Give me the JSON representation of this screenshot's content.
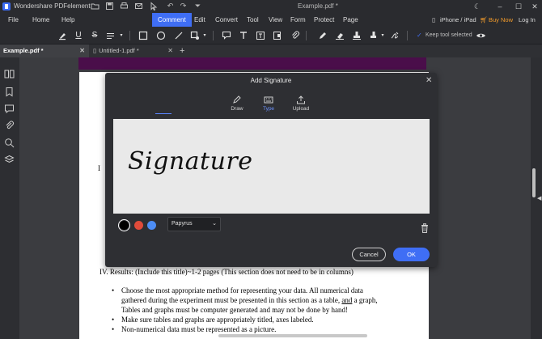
{
  "app": {
    "name": "Wondershare PDFelement",
    "document_title": "Example.pdf *"
  },
  "menu": {
    "items": [
      "File",
      "Home",
      "Help",
      "Comment",
      "Edit",
      "Convert",
      "Tool",
      "View",
      "Form",
      "Protect",
      "Page"
    ],
    "active": "Comment",
    "device": "iPhone / iPad",
    "buy_now": "Buy Now",
    "login": "Log In"
  },
  "toolbar": {
    "keep_tool_selected": "Keep tool selected"
  },
  "tabs": [
    {
      "label": "Example.pdf *",
      "active": true
    },
    {
      "label": "Untitled-1.pdf *",
      "active": false
    }
  ],
  "dialog": {
    "title": "Add Signature",
    "modes": [
      {
        "label": "Draw",
        "icon": "pen-draw-icon"
      },
      {
        "label": "Type",
        "icon": "keyboard-icon"
      },
      {
        "label": "Upload",
        "icon": "upload-icon"
      }
    ],
    "active_mode": "Type",
    "signature_text": "Signature",
    "colors": [
      "#000000",
      "#e04b3a",
      "#4d8df5"
    ],
    "selected_color": "#000000",
    "font": "Papyrus",
    "cancel_label": "Cancel",
    "ok_label": "OK"
  },
  "document": {
    "stray_letter": "I",
    "heading": "IV. Results: (Include this title)~1-2 pages (This section does not need to be in columns)",
    "bullets": [
      "Choose the most appropriate method for representing your data. All numerical data",
      "gathered during the experiment must be presented in this section as a table, ",
      "and",
      " a graph,",
      "Tables and graphs must be computer generated and may not be done by hand!",
      "Make sure tables and graphs are appropriately titled, axes labeled.",
      "Non-numerical data must be represented as a picture."
    ]
  },
  "colors": {
    "accent": "#3f6ef5",
    "buy_now": "#f29b2b",
    "dark_bg": "#2a2b2f"
  }
}
